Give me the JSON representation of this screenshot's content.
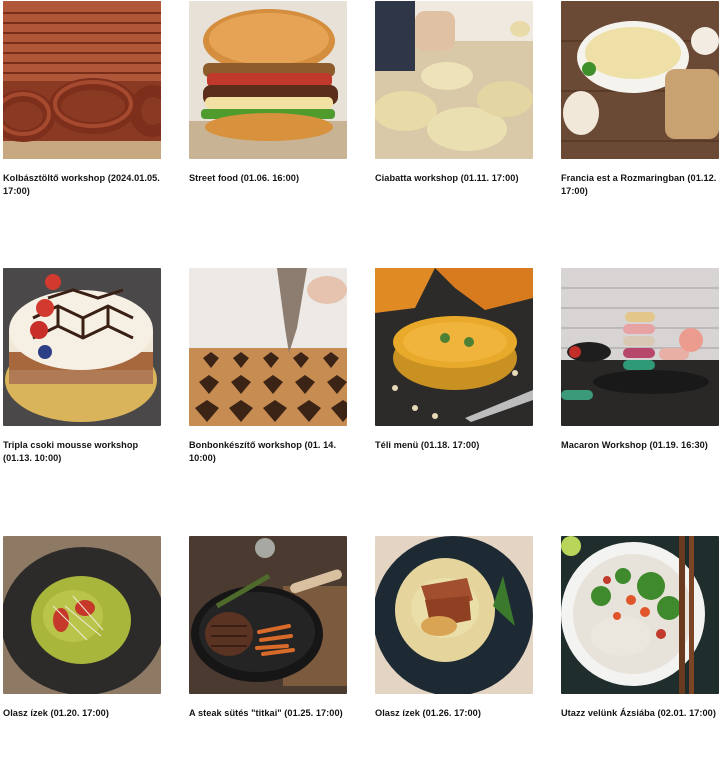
{
  "events": [
    {
      "title": "Kolbásztöltő workshop (2024.01.05. 17:00)",
      "image": "sausages-photo"
    },
    {
      "title": "Street food (01.06. 16:00)",
      "image": "burger-photo"
    },
    {
      "title": "Ciabatta workshop (01.11. 17:00)",
      "image": "ciabatta-bread-photo"
    },
    {
      "title": "Francia est a Rozmaringban (01.12. 17:00)",
      "image": "cream-soup-photo"
    },
    {
      "title": "Tripla csoki mousse workshop (01.13. 10:00)",
      "image": "mousse-cake-photo"
    },
    {
      "title": "Bonbonkészítő workshop (01. 14. 10:00)",
      "image": "bonbon-mold-photo"
    },
    {
      "title": "Téli menü (01.18. 17:00)",
      "image": "pumpkin-soup-photo"
    },
    {
      "title": "Macaron Workshop (01.19. 16:30)",
      "image": "macarons-photo"
    },
    {
      "title": "Olasz ízek (01.20. 17:00)",
      "image": "pesto-pasta-photo"
    },
    {
      "title": "A steak sütés \"titkai\" (01.25. 17:00)",
      "image": "steak-pan-photo"
    },
    {
      "title": "Olasz ízek (01.26. 17:00)",
      "image": "polenta-dish-photo"
    },
    {
      "title": "Utazz velünk Ázsiába (02.01. 17:00)",
      "image": "asian-bowl-photo"
    }
  ]
}
